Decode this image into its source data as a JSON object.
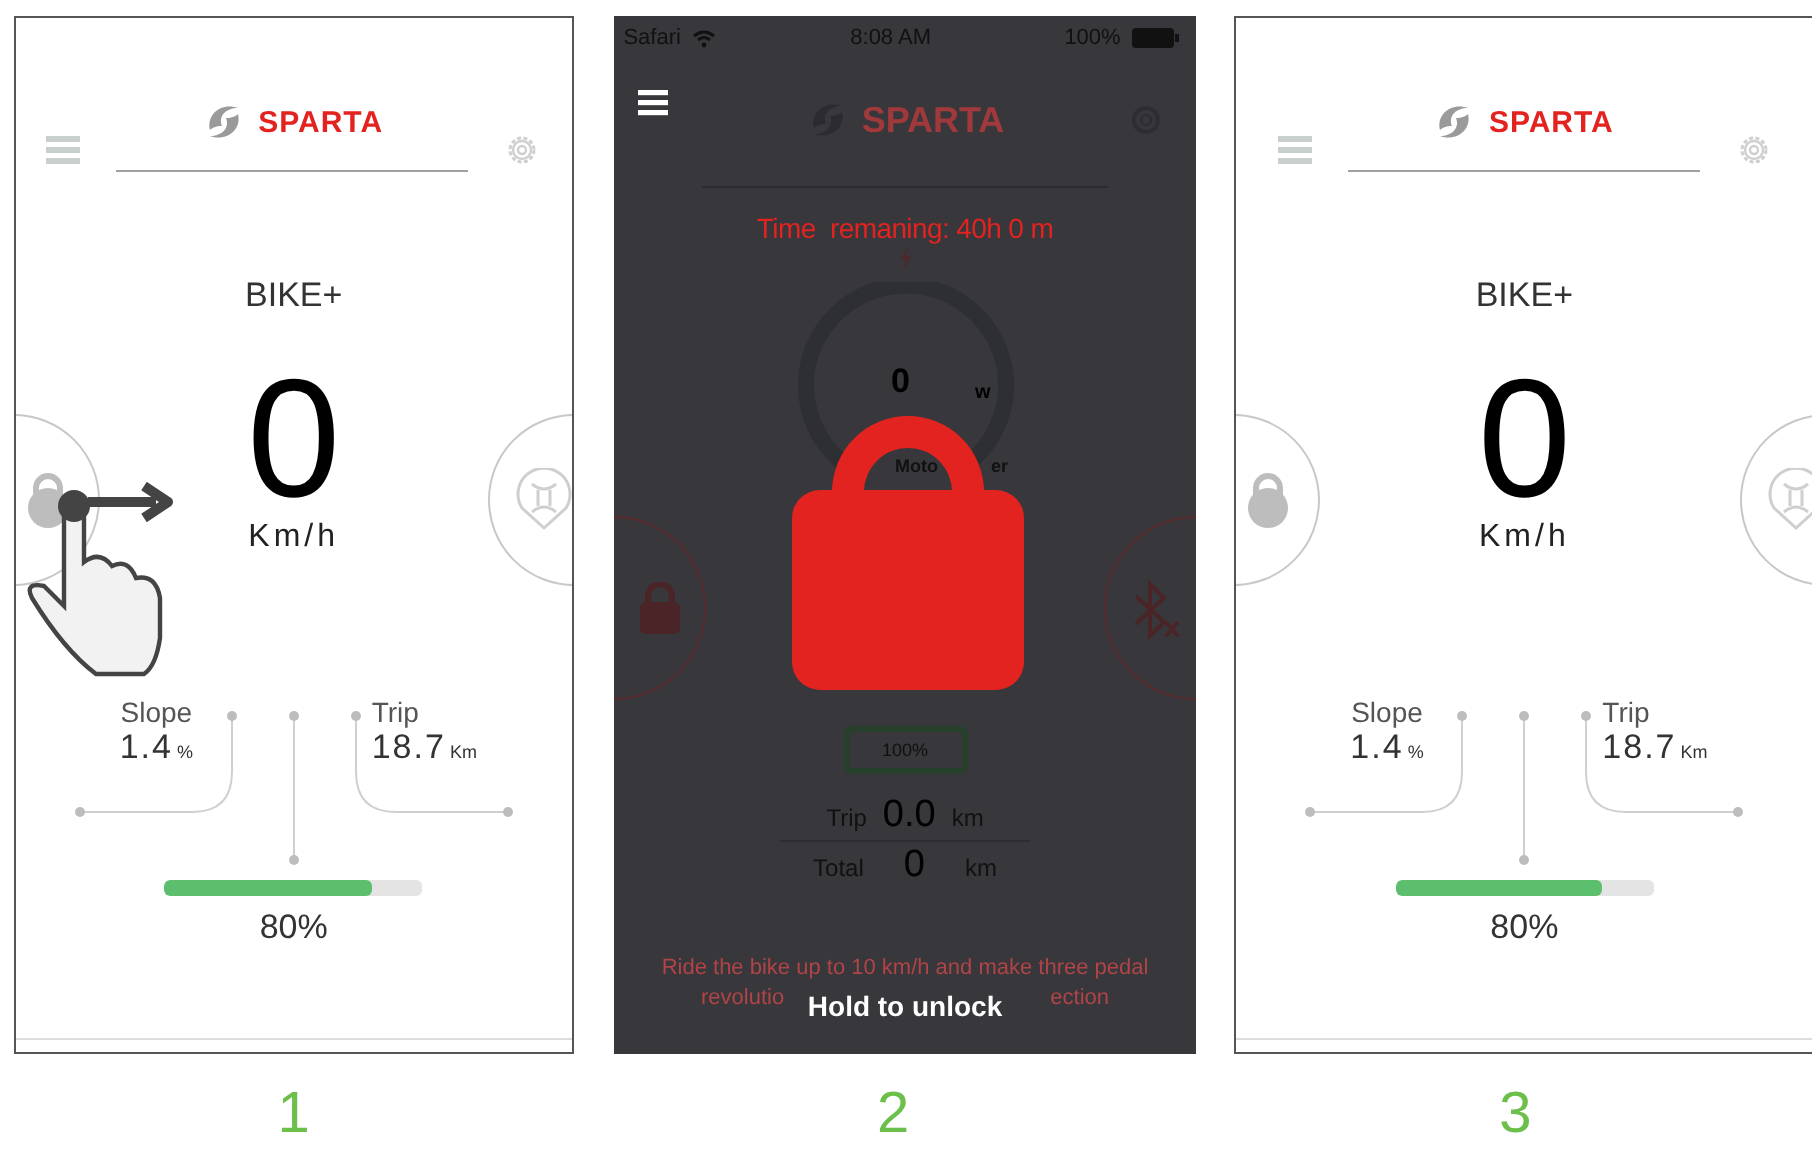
{
  "panels": [
    {
      "kind": "dashboard",
      "step": "1",
      "brand": "SPARTA",
      "mode": "BIKE+",
      "speed": "0",
      "speed_unit": "Km/h",
      "stats": [
        {
          "label": "Slope",
          "value": "1.4",
          "unit": "%"
        },
        {
          "label": "Trip",
          "value": "18.7",
          "unit": "Km"
        }
      ],
      "battery": {
        "level": 0.8,
        "reading": "80%"
      },
      "swipe_hint": true
    },
    {
      "kind": "locked",
      "step": "2",
      "status_bar": {
        "carrier": "Safari",
        "time": "8:08 AM",
        "battery": "100%"
      },
      "brand": "SPARTA",
      "time_remaining": "Time  remaning: 40h 0 m",
      "power": {
        "value": "0",
        "unit": "w",
        "label_parts": [
          "Moto",
          "er"
        ]
      },
      "battery": {
        "reading": "100%"
      },
      "trip": {
        "label": "Trip",
        "value": "0.0",
        "unit": "km"
      },
      "total": {
        "label": "Total",
        "value": "0",
        "unit": "km"
      },
      "hint_line": "Ride the bike up to 10 km/h and make three pedal",
      "hint_parts": [
        "revolutio",
        "ection"
      ],
      "unlock_label": "Hold to unlock"
    },
    {
      "kind": "dashboard",
      "step": "3",
      "brand": "SPARTA",
      "mode": "BIKE+",
      "speed": "0",
      "speed_unit": "Km/h",
      "stats": [
        {
          "label": "Slope",
          "value": "1.4",
          "unit": "%"
        },
        {
          "label": "Trip",
          "value": "18.7",
          "unit": "Km"
        }
      ],
      "battery": {
        "level": 0.8,
        "reading": "80%"
      },
      "swipe_hint": false
    }
  ]
}
